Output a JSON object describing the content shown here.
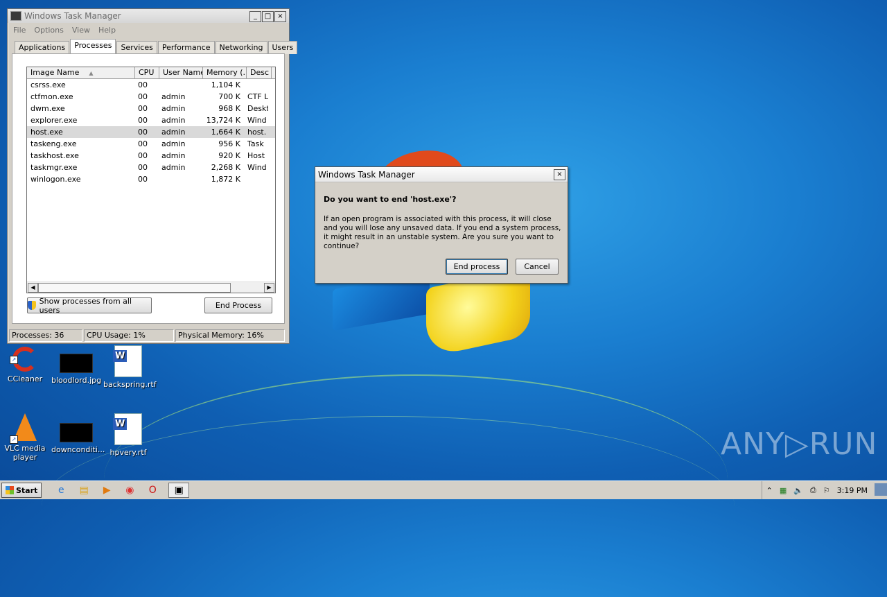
{
  "task_manager": {
    "title": "Windows Task Manager",
    "window_buttons": [
      "_",
      "□",
      "×"
    ],
    "menu": [
      "File",
      "Options",
      "View",
      "Help"
    ],
    "tabs": [
      "Applications",
      "Processes",
      "Services",
      "Performance",
      "Networking",
      "Users"
    ],
    "active_tab": "Processes",
    "columns": [
      "Image Name",
      "CPU",
      "User Name",
      "Memory (...",
      "Desc"
    ],
    "sort_indicator": "▲",
    "processes": [
      {
        "name": "csrss.exe",
        "cpu": "00",
        "user": "",
        "memory": "1,104 K",
        "desc": ""
      },
      {
        "name": "ctfmon.exe",
        "cpu": "00",
        "user": "admin",
        "memory": "700 K",
        "desc": "CTF L"
      },
      {
        "name": "dwm.exe",
        "cpu": "00",
        "user": "admin",
        "memory": "968 K",
        "desc": "Deskt"
      },
      {
        "name": "explorer.exe",
        "cpu": "00",
        "user": "admin",
        "memory": "13,724 K",
        "desc": "Wind"
      },
      {
        "name": "host.exe",
        "cpu": "00",
        "user": "admin",
        "memory": "1,664 K",
        "desc": "host."
      },
      {
        "name": "taskeng.exe",
        "cpu": "00",
        "user": "admin",
        "memory": "956 K",
        "desc": "Task"
      },
      {
        "name": "taskhost.exe",
        "cpu": "00",
        "user": "admin",
        "memory": "920 K",
        "desc": "Host"
      },
      {
        "name": "taskmgr.exe",
        "cpu": "00",
        "user": "admin",
        "memory": "2,268 K",
        "desc": "Wind"
      },
      {
        "name": "winlogon.exe",
        "cpu": "00",
        "user": "",
        "memory": "1,872 K",
        "desc": ""
      }
    ],
    "selected_process": "host.exe",
    "show_all_label": "Show processes from all users",
    "end_process_label": "End Process",
    "status": {
      "processes": "Processes: 36",
      "cpu": "CPU Usage: 1%",
      "memory": "Physical Memory: 16%"
    }
  },
  "dialog": {
    "title": "Windows Task Manager",
    "close": "×",
    "question": "Do you want to end 'host.exe'?",
    "message": "If an open program is associated with this process, it will close and you will lose any unsaved data. If you end a system process, it might result in an unstable system. Are you sure you want to continue?",
    "end_button": "End process",
    "cancel_button": "Cancel"
  },
  "desktop_icons": [
    {
      "label": "CCleaner",
      "icon": "ccleaner-icon"
    },
    {
      "label": "bloodlord.jpg",
      "icon": "image-file-icon"
    },
    {
      "label": "backspring.rtf",
      "icon": "word-document-icon"
    },
    {
      "label": "VLC media player",
      "icon": "vlc-icon"
    },
    {
      "label": "downconditi...",
      "icon": "image-file-icon"
    },
    {
      "label": "hpvery.rtf",
      "icon": "word-document-icon"
    }
  ],
  "watermark": "ANY▷RUN",
  "taskbar": {
    "start_label": "Start",
    "pinned": [
      "internet-explorer-icon",
      "file-explorer-icon",
      "media-player-icon",
      "chrome-icon",
      "opera-icon",
      "task-manager-icon"
    ],
    "tray_icons": [
      "show-hidden-icon",
      "network-icon",
      "volume-icon",
      "printer-icon",
      "action-center-flag-icon"
    ],
    "clock": "3:19 PM"
  }
}
